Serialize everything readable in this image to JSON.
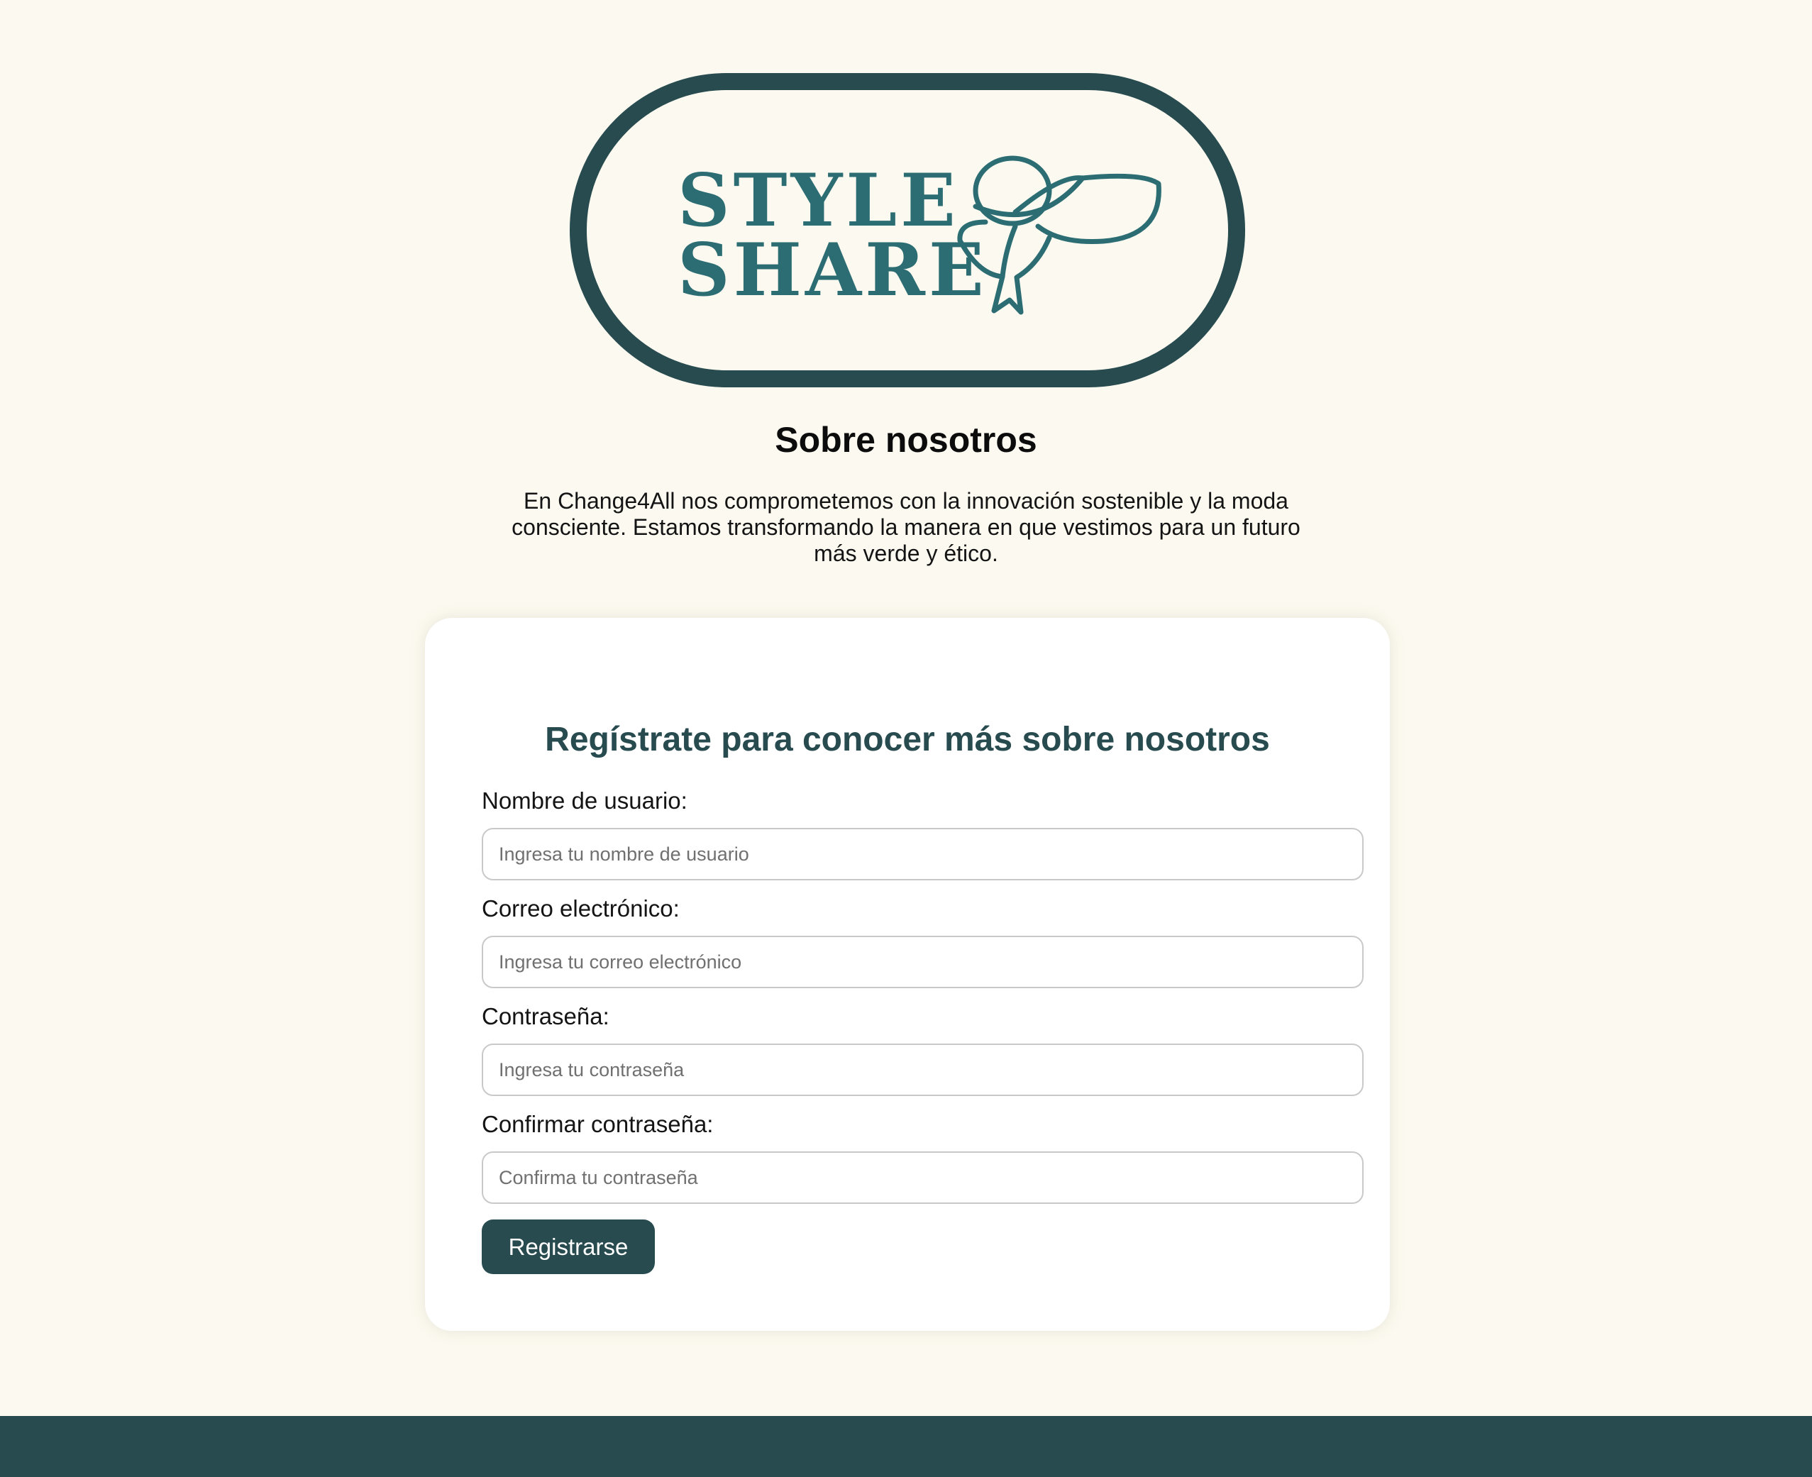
{
  "logo": {
    "line1": "STYLE",
    "line2": "SHARE"
  },
  "about": {
    "title": "Sobre nosotros",
    "text": "En Change4All nos comprometemos con la innovación sostenible y la moda consciente. Estamos transformando la manera en que vestimos para un futuro más verde y ético."
  },
  "form": {
    "title": "Regístrate para conocer más sobre nosotros",
    "fields": [
      {
        "label": "Nombre de usuario:",
        "placeholder": "Ingresa tu nombre de usuario",
        "value": ""
      },
      {
        "label": "Correo electrónico:",
        "placeholder": "Ingresa tu correo electrónico",
        "value": ""
      },
      {
        "label": "Contraseña:",
        "placeholder": "Ingresa tu contraseña",
        "value": ""
      },
      {
        "label": "Confirmar contraseña:",
        "placeholder": "Confirma tu contraseña",
        "value": ""
      }
    ],
    "submit_label": "Registrarse"
  },
  "colors": {
    "background": "#fcfaf0",
    "brand": "#274b4f",
    "logo_text": "#2c6d73",
    "card": "#ffffff"
  }
}
